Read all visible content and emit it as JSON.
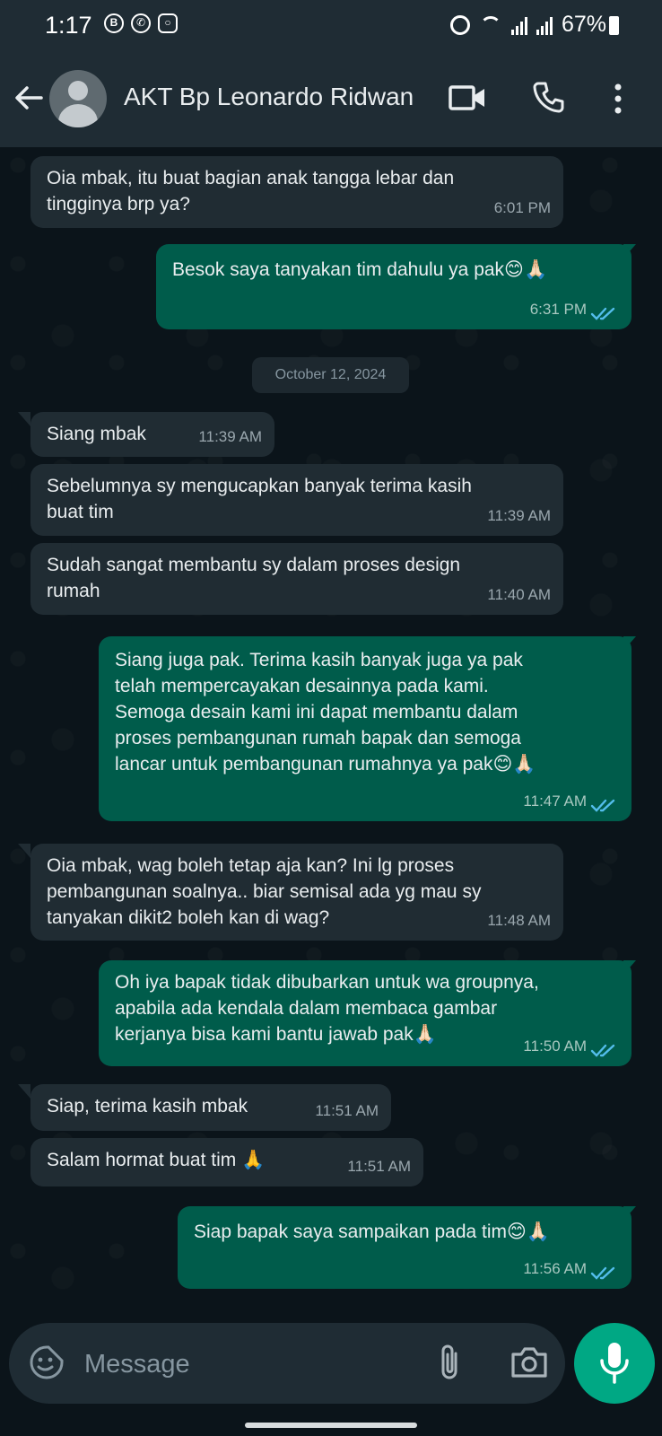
{
  "status_bar": {
    "time": "1:17",
    "battery": "67%",
    "notification_icons": [
      "b-icon",
      "whatsapp-icon",
      "instagram-icon"
    ]
  },
  "header": {
    "contact_name": "AKT Bp Leonardo Ridwan"
  },
  "date_chip": "October 12, 2024",
  "messages": [
    {
      "dir": "in",
      "text": "Oia mbak, itu buat bagian anak tangga lebar dan\ntingginya brp ya?",
      "time": "6:01 PM"
    },
    {
      "dir": "out",
      "text": "Besok saya tanyakan tim dahulu ya pak😊🙏🏻",
      "time": "6:31 PM"
    },
    {
      "dir": "in",
      "text": "Siang mbak",
      "time": "11:39 AM"
    },
    {
      "dir": "in",
      "text": "Sebelumnya sy mengucapkan banyak terima kasih\nbuat tim",
      "time": "11:39 AM"
    },
    {
      "dir": "in",
      "text": "Sudah sangat membantu sy dalam proses design\nrumah",
      "time": "11:40 AM"
    },
    {
      "dir": "out",
      "text": "Siang juga pak. Terima kasih banyak juga ya pak\ntelah mempercayakan desainnya pada kami.\nSemoga desain kami ini dapat membantu dalam\nproses pembangunan rumah bapak dan semoga\nlancar untuk pembangunan rumahnya ya pak😊🙏🏻",
      "time": "11:47 AM"
    },
    {
      "dir": "in",
      "text": "Oia mbak, wag boleh tetap aja kan? Ini lg proses\npembangunan soalnya.. biar semisal ada yg mau sy\ntanyakan dikit2 boleh kan di wag?",
      "time": "11:48 AM"
    },
    {
      "dir": "out",
      "text": "Oh iya bapak tidak dibubarkan untuk wa groupnya,\napabila ada kendala dalam membaca gambar\nkerjanya bisa kami bantu jawab pak🙏🏻",
      "time": "11:50 AM"
    },
    {
      "dir": "in",
      "text": "Siap, terima kasih mbak",
      "time": "11:51 AM"
    },
    {
      "dir": "in",
      "text": "Salam hormat buat tim 🙏",
      "time": "11:51 AM"
    },
    {
      "dir": "out",
      "text": "Siap bapak saya sampaikan pada tim😊🙏🏻",
      "time": "11:56 AM"
    }
  ],
  "input": {
    "placeholder": "Message"
  },
  "colors": {
    "background": "#0b141a",
    "header": "#1f2c34",
    "incoming_bubble": "#202c33",
    "outgoing_bubble": "#005c4b",
    "accent": "#00a884",
    "read_ticks": "#53bdeb"
  }
}
